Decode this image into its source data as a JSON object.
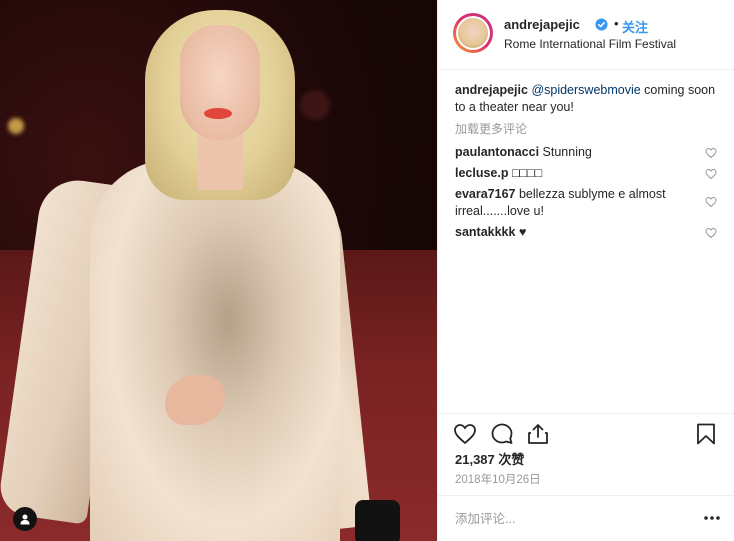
{
  "post": {
    "author": {
      "username": "andrejapejic",
      "verified": true,
      "follow_label": "关注",
      "location": "Rome International Film Festival"
    },
    "caption": {
      "username": "andrejapejic",
      "mention": "@spiderswebmovie",
      "text": " coming soon to a theater near you!"
    },
    "load_more_label": "加载更多评论",
    "comments": [
      {
        "username": "paulantonacci",
        "text": "Stunning"
      },
      {
        "username": "lecluse.p",
        "text": "□□□□"
      },
      {
        "username": "evara7167",
        "text": "bellezza sublyme e almost irreal.......love u!"
      },
      {
        "username": "santakkkk",
        "text": "♥"
      }
    ],
    "likes_label": "21,387 次赞",
    "date": "2018年10月26日",
    "add_comment_placeholder": "添加评论..."
  },
  "colors": {
    "accent": "#3897f0",
    "text": "#262626",
    "muted": "#999999",
    "border": "#efefef"
  },
  "icons": {
    "like": "heart-icon",
    "comment": "comment-icon",
    "share": "share-icon",
    "save": "bookmark-icon",
    "more": "more-dots-icon",
    "verified": "verified-badge-icon",
    "user_tag": "user-tag-icon"
  }
}
